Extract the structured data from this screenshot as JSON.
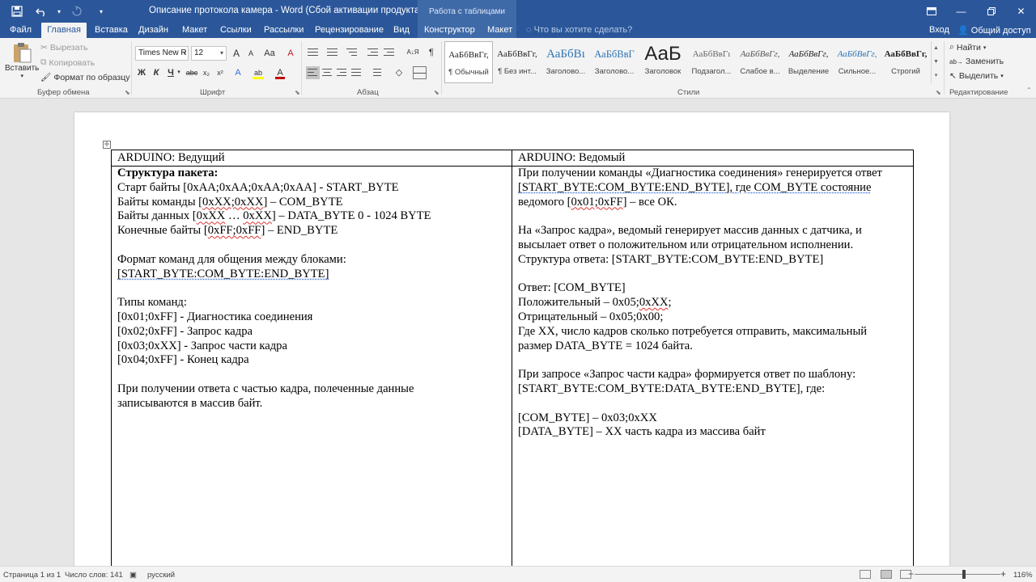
{
  "window": {
    "title": "Описание протокола камера - Word (Сбой активации продукта)",
    "contextual_header": "Работа с таблицами",
    "controls": [
      "ribbon-options",
      "minimize",
      "restore",
      "close"
    ]
  },
  "qat": {
    "icons": [
      "save-icon",
      "undo-icon",
      "redo-icon",
      "customize-qat-icon"
    ]
  },
  "tabs": [
    {
      "label": "Файл"
    },
    {
      "label": "Главная"
    },
    {
      "label": "Вставка"
    },
    {
      "label": "Дизайн"
    },
    {
      "label": "Макет"
    },
    {
      "label": "Ссылки"
    },
    {
      "label": "Рассылки"
    },
    {
      "label": "Рецензирование"
    },
    {
      "label": "Вид"
    },
    {
      "label": "Конструктор"
    },
    {
      "label": "Макет"
    }
  ],
  "active_tab": "Главная",
  "tell_me": "Что вы хотите сделать?",
  "account": {
    "sign_in": "Вход",
    "share": "Общий доступ"
  },
  "ribbon": {
    "clipboard": {
      "paste": "Вставить",
      "cut": "Вырезать",
      "copy": "Копировать",
      "format_painter": "Формат по образцу",
      "label": "Буфер обмена"
    },
    "font": {
      "name": "Times New R",
      "size": "12",
      "bold": "Ж",
      "italic": "К",
      "underline": "Ч",
      "strike": "abc",
      "subscript": "x₂",
      "superscript": "x²",
      "grow": "A",
      "shrink": "A",
      "case": "Aa",
      "clear": "A",
      "effects": "A",
      "highlight": "ab",
      "color": "A",
      "label": "Шрифт",
      "accent_red": "#c00000",
      "accent_yellow": "#ffff00"
    },
    "paragraph": {
      "label": "Абзац",
      "pilcrow": "¶",
      "sort": "А↓Я"
    },
    "styles": {
      "label": "Стили",
      "items": [
        {
          "preview": "АаБбВвГг,",
          "name": "¶ Обычный"
        },
        {
          "preview": "АаБбВвГг,",
          "name": "¶ Без инт..."
        },
        {
          "preview": "АаБбВı",
          "name": "Заголово..."
        },
        {
          "preview": "АаБбВвГ",
          "name": "Заголово..."
        },
        {
          "preview": "АаБ",
          "name": "Заголовок"
        },
        {
          "preview": "АаБбВвГı",
          "name": "Подзагол..."
        },
        {
          "preview": "АаБбВвГг,",
          "name": "Слабое в..."
        },
        {
          "preview": "АаБбВвГг,",
          "name": "Выделение"
        },
        {
          "preview": "АаБбВвГг,",
          "name": "Сильное..."
        },
        {
          "preview": "АаБбВвГг,",
          "name": "Строгий"
        }
      ],
      "heading_color": "#2e74b5"
    },
    "editing": {
      "find": "Найти",
      "replace": "Заменить",
      "select": "Выделить",
      "label": "Редактирование"
    }
  },
  "document": {
    "col1_header": "ARDUINO: Ведущий",
    "col2_header": "ARDUINO: Ведомый",
    "col1": {
      "title": "Структура пакета:",
      "start": "Старт байты [0xAA;0xAA;0xAA;0xAA] - START_BYTE",
      "cmd_a": "Байты команды [",
      "cmd_b": "0xXX;0xXX",
      "cmd_c": "] – COM_BYTE",
      "data_a": "Байты данных [",
      "data_b": "0xXX",
      "data_c": " … ",
      "data_d": "0xXX",
      "data_e": "] – DATA_BYTE 0 - 1024 BYTE",
      "end_a": "Конечные байты [",
      "end_b": "0xFF;0xFF",
      "end_c": "] – END_BYTE",
      "fmt_title": "Формат команд для общения между блоками:",
      "fmt_a": "[START_BYTE:COM_BYTE:END_BYTE]",
      "types_title": "Типы команд:",
      "t1": "[0x01;0xFF] - Диагностика соединения",
      "t2": "[0x02;0xFF] -  Запрос кадра",
      "t3": "[0x03;0xXX] - Запрос части кадра",
      "t4": "[0x04;0xFF] - Конец кадра",
      "rx1": "При получении ответа с частью кадра, полеченные данные",
      "rx2": "записываются в массив байт."
    },
    "col2": {
      "p1a": "При получении команды «Диагностика соединения» генерируется ответ",
      "p1b": "[START_BYTE:COM_BYTE:END_BYTE], где COM_BYTE состояние",
      "p1c_a": "ведомого [",
      "p1c_b": "0x01;0xFF",
      "p1c_c": "] – все ОК.",
      "p2a": "На «Запрос кадра», ведомый генерирует массив данных с датчика, и",
      "p2b": "высылает ответ о положительном или отрицательном исполнении.",
      "p2c": "Структура ответа: [START_BYTE:COM_BYTE:END_BYTE]",
      "ans": "Ответ: [COM_BYTE]",
      "pos_a": "Положительный – 0x05;",
      "pos_b": "0xXX",
      "pos_c": ";",
      "neg": "Отрицательный – 0x05;0x00;",
      "xx1": "Где XX, число кадров сколько потребуется отправить, максимальный",
      "xx2": "размер DATA_BYTE = 1024 байта.",
      "pq1": "При запросе «Запрос части кадра» формируется ответ по шаблону:",
      "pq2": "[START_BYTE:COM_BYTE:DATA_BYTE:END_BYTE], где:",
      "cb": "[COM_BYTE] – 0x03;0xXX",
      "db": "[DATA_BYTE] – XX часть кадра из массива байт"
    }
  },
  "status": {
    "page": "Страница 1 из 1",
    "words": "Число слов: 141",
    "language": "русский",
    "zoom": "116%",
    "zoom_minus": "−",
    "zoom_plus": "+",
    "zoom_level": 116
  }
}
